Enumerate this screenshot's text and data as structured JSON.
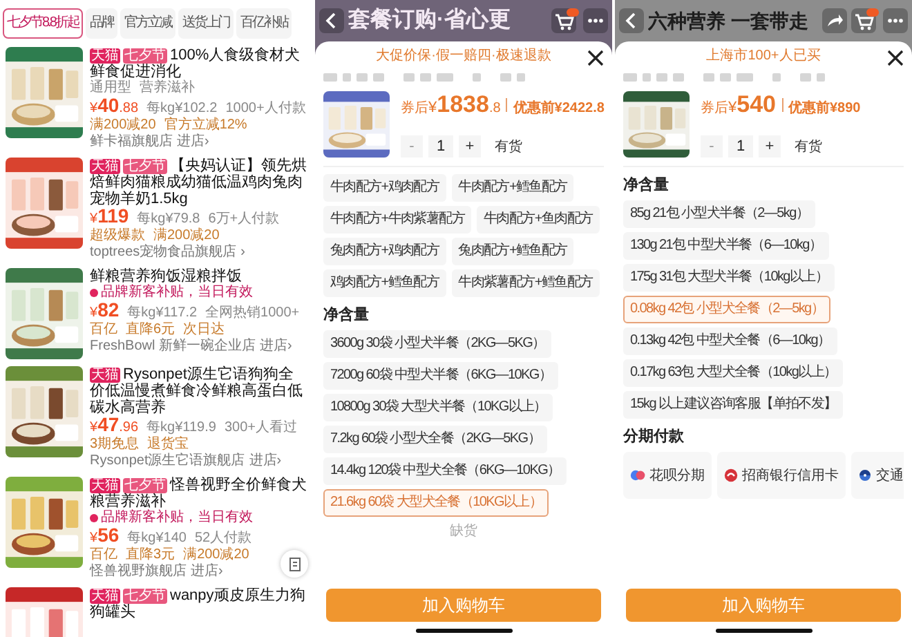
{
  "search_results": {
    "filters": [
      {
        "label": "七夕节8.8折起",
        "selected": true
      },
      {
        "label": "品牌",
        "selected": false
      },
      {
        "label": "官方立减",
        "selected": false
      },
      {
        "label": "送货上门",
        "selected": false
      },
      {
        "label": "百亿补贴",
        "selected": false
      }
    ],
    "products": [
      {
        "badges": [
          {
            "label": "天猫",
            "kind": "tmall"
          },
          {
            "label": "七夕节",
            "kind": "festival"
          }
        ],
        "title": "100%人食级食材犬鲜食促进消化",
        "details": [
          "通用型",
          "营养滋补"
        ],
        "price": {
          "currency": "¥",
          "whole": "40",
          "decimal": ".88"
        },
        "unit_price": "每kg¥102.2",
        "sales": "1000+人付款",
        "promos": [
          "满200减20",
          "官方立减12%"
        ],
        "store": "鲜卡福旗舰店",
        "store_link": "进店›"
      },
      {
        "badges": [
          {
            "label": "天猫",
            "kind": "tmall"
          },
          {
            "label": "七夕节",
            "kind": "festival"
          }
        ],
        "title": "【央妈认证】领先烘焙鲜肉猫粮成幼猫低温鸡肉兔肉宠物羊奶1.5kg",
        "price": {
          "currency": "¥",
          "whole": "119"
        },
        "unit_price": "每kg¥79.8",
        "sales": "6万+人付款",
        "promos": [
          "超级爆款",
          "满200减20"
        ],
        "store": "toptrees宠物食品旗舰店",
        "store_link": "›"
      },
      {
        "title": "鲜粮营养狗饭湿粮拌饭",
        "notice": "品牌新客补贴，当日有效",
        "price": {
          "currency": "¥",
          "whole": "82"
        },
        "unit_price": "每kg¥117.2",
        "sales": "全网热销1000+",
        "promos": [
          "百亿",
          "直降6元",
          "次日达"
        ],
        "store": "FreshBowl 新鲜一碗企业店",
        "store_link": "进店›"
      },
      {
        "badges": [
          {
            "label": "天猫",
            "kind": "tmall"
          }
        ],
        "title": "Rysonpet源生它语狗狗全价低温慢煮鲜食冷鲜粮高蛋白低碳水高营养",
        "price": {
          "currency": "¥",
          "whole": "47",
          "decimal": ".96"
        },
        "unit_price": "每kg¥119.9",
        "sales": "300+人看过",
        "promos": [
          "3期免息",
          "退货宝"
        ],
        "store": "Rysonpet源生它语旗舰店",
        "store_link": "进店›"
      },
      {
        "badges": [
          {
            "label": "天猫",
            "kind": "tmall"
          },
          {
            "label": "七夕节",
            "kind": "festival"
          }
        ],
        "title": "怪兽视野全价鲜食犬粮营养滋补",
        "notice": "品牌新客补贴，当日有效",
        "price": {
          "currency": "¥",
          "whole": "56"
        },
        "unit_price": "每kg¥140",
        "sales": "52人付款",
        "promos": [
          "百亿",
          "直降3元",
          "满200减20"
        ],
        "store": "怪兽视野旗舰店",
        "store_link": "进店›"
      },
      {
        "badges": [
          {
            "label": "天猫",
            "kind": "tmall"
          },
          {
            "label": "七夕节",
            "kind": "festival"
          }
        ],
        "title": "wanpy顽皮原生力狗狗罐头"
      }
    ]
  },
  "sheets": [
    {
      "page_title": "套餐订购·省心更",
      "top_icons": [
        {
          "kind": "cart"
        },
        {
          "kind": "more"
        }
      ],
      "header_note": "大促价保·假一赔四·极速退款",
      "price_label": "券后",
      "currency": "¥",
      "price": "1838",
      "price_decimal": ".8",
      "original_price": "优惠前¥2422.8",
      "decrement": "-",
      "quantity": "1",
      "increment": "+",
      "stock": "有货",
      "option_groups": [
        {
          "options": [
            {
              "label": "牛肉配方+鸡肉配方",
              "selected": false
            },
            {
              "label": "牛肉配方+鳕鱼配方",
              "selected": false
            },
            {
              "label": "牛肉配方+牛肉紫薯配方",
              "selected": false
            },
            {
              "label": "牛肉配方+鱼肉配方",
              "selected": false
            },
            {
              "label": "兔肉配方+鸡肉配方",
              "selected": false
            },
            {
              "label": "兔肉配方+鳕鱼配方",
              "selected": false
            },
            {
              "label": "鸡肉配方+鳕鱼配方",
              "selected": false
            },
            {
              "label": "牛肉紫薯配方+鳕鱼配方",
              "selected": false
            }
          ]
        },
        {
          "title": "净含量",
          "options": [
            {
              "label": "3600g 30袋 小型犬半餐（2KG—5KG）",
              "selected": false
            },
            {
              "label": "7200g 60袋 中型犬半餐（6KG—10KG）",
              "selected": false
            },
            {
              "label": "10800g 30袋 大型犬半餐（10KG以上）",
              "selected": false
            },
            {
              "label": "7.2kg 60袋 小型犬全餐（2KG—5KG）",
              "selected": false
            },
            {
              "label": "14.4kg 120袋 中型犬全餐（6KG—10KG）",
              "selected": false
            },
            {
              "label": "21.6kg 60袋 大型犬全餐（10KG以上）",
              "selected": true
            }
          ]
        }
      ],
      "stock_note": "缺货",
      "cart_button": "加入购物车"
    },
    {
      "page_title": "六种营养 一套带走",
      "top_icons": [
        {
          "kind": "share"
        },
        {
          "kind": "cart"
        },
        {
          "kind": "more"
        }
      ],
      "header_note": "上海市100+人已买",
      "price_label": "券后",
      "currency": "¥",
      "price": "540",
      "original_price": "优惠前¥890",
      "decrement": "-",
      "quantity": "1",
      "increment": "+",
      "stock": "有货",
      "option_groups": [
        {
          "title": "净含量",
          "options": [
            {
              "label": "85g 21包 小型犬半餐（2—5kg）",
              "selected": false
            },
            {
              "label": "130g 21包 中型犬半餐（6—10kg）",
              "selected": false
            },
            {
              "label": "175g 31包 大型犬半餐（10kg以上）",
              "selected": false
            },
            {
              "label": "0.08kg 42包 小型犬全餐（2—5kg）",
              "selected": true
            },
            {
              "label": "0.13kg 42包 中型犬全餐（6—10kg）",
              "selected": false
            },
            {
              "label": "0.17kg 63包 大型犬全餐（10kg以上）",
              "selected": false
            },
            {
              "label": "15kg 以上建议咨询客服【单拍不发】",
              "selected": false
            }
          ]
        }
      ],
      "installments": {
        "title": "分期付款",
        "options": [
          {
            "label": "花呗分期",
            "kind": "huabei"
          },
          {
            "label": "招商银行信用卡",
            "kind": "cmb"
          },
          {
            "label": "交通",
            "kind": "bocom"
          }
        ]
      },
      "cart_button": "加入购物车"
    }
  ]
}
